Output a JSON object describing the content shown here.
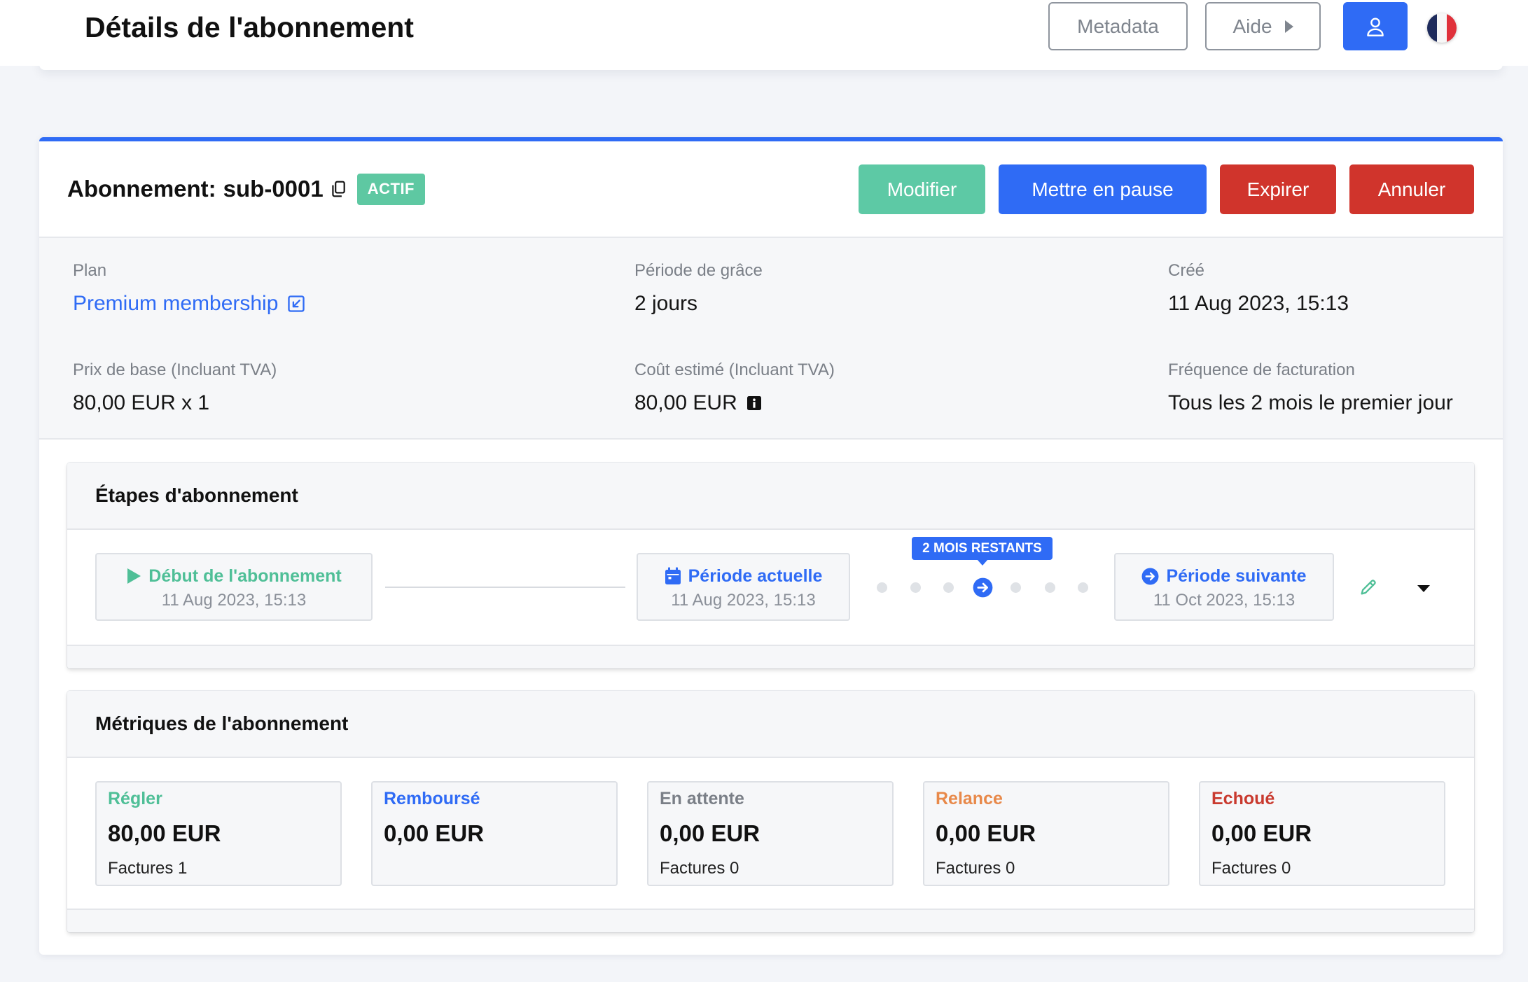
{
  "header": {
    "title": "Détails de l'abonnement",
    "metadata_button": "Metadata",
    "help_button": "Aide",
    "help_icon": "caret-right-icon",
    "user_icon": "user-icon",
    "language_icon": "flag-fr-icon"
  },
  "subscription": {
    "heading_label": "Abonnement:",
    "id": "sub-0001",
    "copy_icon": "copy-icon",
    "status": "ACTIF",
    "actions": {
      "edit": "Modifier",
      "pause": "Mettre en pause",
      "expire": "Expirer",
      "cancel": "Annuler"
    }
  },
  "details": {
    "plan": {
      "label": "Plan",
      "value": "Premium membership",
      "icon": "external-link-icon"
    },
    "grace_period": {
      "label": "Période de grâce",
      "value": "2 jours"
    },
    "created": {
      "label": "Créé",
      "value": "11 Aug 2023, 15:13"
    },
    "base_price": {
      "label": "Prix de base (Incluant TVA)",
      "value": "80,00 EUR x 1"
    },
    "estimated_cost": {
      "label": "Coût estimé (Incluant TVA)",
      "value": "80,00 EUR",
      "icon": "info-icon"
    },
    "billing_frequency": {
      "label": "Fréquence de facturation",
      "value": "Tous les 2 mois le premier jour"
    }
  },
  "steps": {
    "title": "Étapes d'abonnement",
    "start": {
      "label": "Début de l'abonnement",
      "date": "11 Aug 2023, 15:13",
      "icon": "play-icon"
    },
    "current": {
      "label": "Période actuelle",
      "date": "11 Aug 2023, 15:13",
      "icon": "calendar-icon"
    },
    "remaining": "2 MOIS RESTANTS",
    "next": {
      "label": "Période suivante",
      "date": "11 Oct 2023, 15:13",
      "icon": "arrow-circle-right-icon"
    },
    "edit_icon": "pencil-icon",
    "expand_icon": "caret-down-icon"
  },
  "metrics": {
    "title": "Métriques de l'abonnement",
    "items": [
      {
        "label": "Régler",
        "amount": "80,00 EUR",
        "invoices": "Factures 1",
        "color": "#4fbf97"
      },
      {
        "label": "Remboursé",
        "amount": "0,00 EUR",
        "color": "#2f6bf5"
      },
      {
        "label": "En attente",
        "amount": "0,00 EUR",
        "invoices": "Factures 0",
        "color": "#7a7f87"
      },
      {
        "label": "Relance",
        "amount": "0,00 EUR",
        "invoices": "Factures 0",
        "color": "#e8894a"
      },
      {
        "label": "Echoué",
        "amount": "0,00 EUR",
        "invoices": "Factures 0",
        "color": "#c93a2f"
      }
    ]
  },
  "colors": {
    "primary": "#2f6bf5",
    "success": "#5dc9a5",
    "danger": "#d0342c",
    "status_active": "#5ec8a2"
  }
}
